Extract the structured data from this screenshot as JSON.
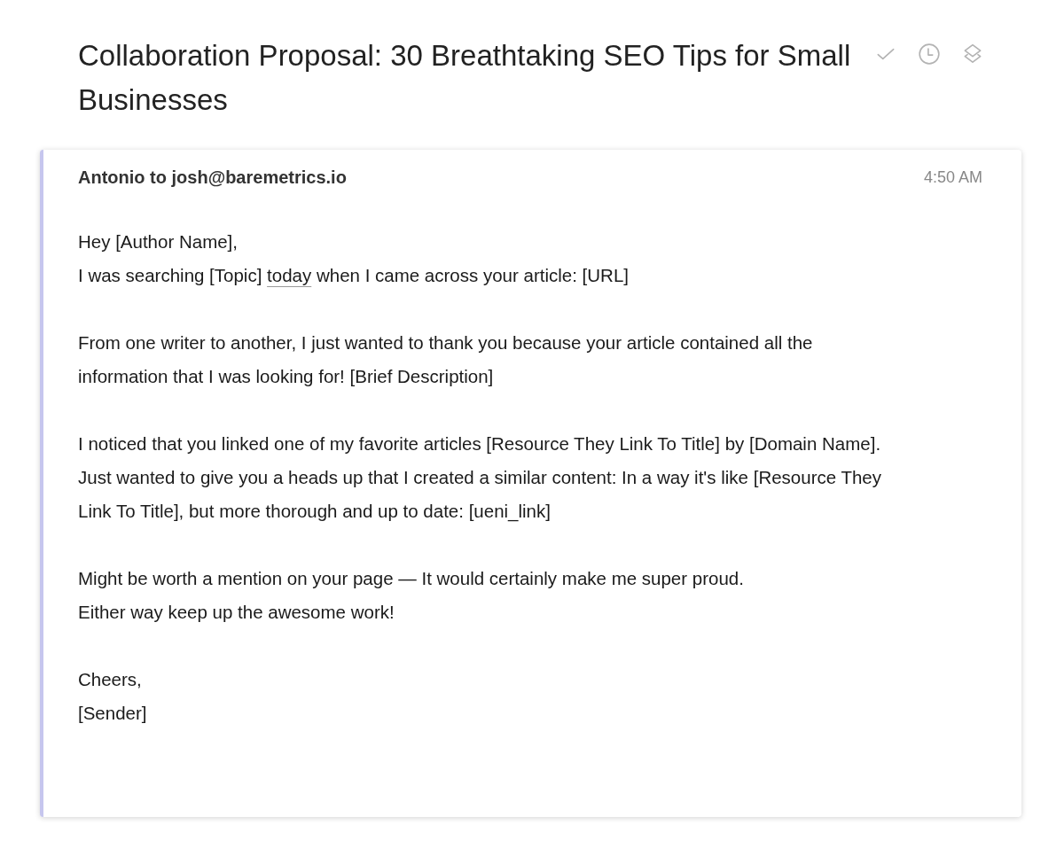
{
  "subject": {
    "lines": [
      "Collaboration Proposal: 30 Breathtaking SEO Tips for Small",
      "Businesses"
    ]
  },
  "actions": [
    {
      "kind": "done"
    },
    {
      "kind": "snooze"
    },
    {
      "kind": "archive"
    }
  ],
  "message": {
    "header": "Antonio to josh@baremetrics.io",
    "time": "4:50 AM",
    "paragraphs": [
      [
        [
          {
            "kind": "plain",
            "text": "Hey [Author Name],"
          }
        ],
        [
          {
            "kind": "plain",
            "text": "I was searching [Topic] "
          },
          {
            "kind": "date",
            "text": "today"
          },
          {
            "kind": "plain",
            "text": " when I came across your article: [URL]"
          }
        ]
      ],
      [
        [
          {
            "kind": "plain",
            "text": "From one writer to another, I just wanted to thank you because your article contained all the"
          }
        ],
        [
          {
            "kind": "plain",
            "text": "information that I was looking for! [Brief Description]"
          }
        ]
      ],
      [
        [
          {
            "kind": "plain",
            "text": "I noticed that you linked one of my favorite articles [Resource They Link To Title] by [Domain Name]."
          }
        ],
        [
          {
            "kind": "plain",
            "text": "Just wanted to give you a heads up that I created a similar content: In a way it's like [Resource They"
          }
        ],
        [
          {
            "kind": "plain",
            "text": "Link To Title], but more thorough and up to date: [ueni_link]"
          }
        ]
      ],
      [
        [
          {
            "kind": "plain",
            "text": "Might be worth a mention on your page — It would certainly make me super proud."
          }
        ],
        [
          {
            "kind": "plain",
            "text": "Either way keep up the awesome work!"
          }
        ]
      ],
      [
        [
          {
            "kind": "plain",
            "text": "Cheers,"
          }
        ],
        [
          {
            "kind": "plain",
            "text": "[Sender]"
          }
        ]
      ]
    ]
  }
}
